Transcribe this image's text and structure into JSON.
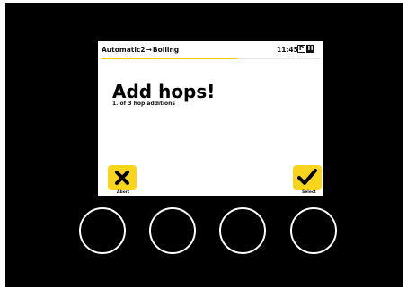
{
  "header": {
    "mode": "Automatic2",
    "arrow": "→",
    "phase": "Boiling",
    "time": "11:45",
    "badge_p": "P",
    "badge_h": "H",
    "progress_fraction": 0.62
  },
  "main": {
    "title": "Add hops!",
    "subtitle": "1. of 3 hop additions"
  },
  "softkeys": {
    "abort": {
      "icon": "close-icon",
      "label": "Abort"
    },
    "select": {
      "icon": "checkmark-icon",
      "label": "Select"
    }
  },
  "hardware_buttons": [
    "button-1",
    "button-2",
    "button-3",
    "button-4"
  ],
  "colors": {
    "accent": "#f7d51d",
    "progress": "#f2cb00",
    "bezel": "#000000",
    "screen": "#ffffff"
  }
}
